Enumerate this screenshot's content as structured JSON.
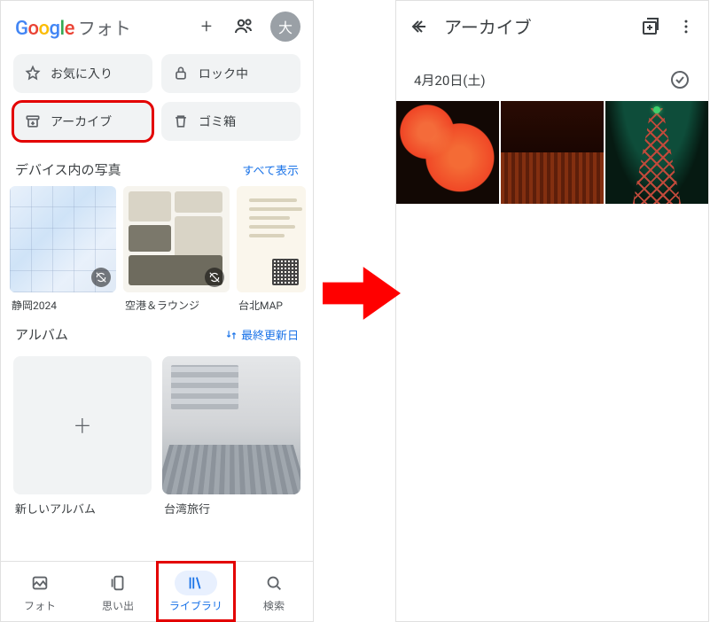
{
  "left": {
    "app_name_suffix": "フォト",
    "avatar_initial": "大",
    "chips": [
      {
        "label": "お気に入り"
      },
      {
        "label": "ロック中"
      },
      {
        "label": "アーカイブ"
      },
      {
        "label": "ゴミ箱"
      }
    ],
    "device_section": {
      "title": "デバイス内の写真",
      "action": "すべて表示",
      "items": [
        {
          "label": "静岡2024"
        },
        {
          "label": "空港＆ラウンジ"
        },
        {
          "label": "台北MAP"
        }
      ]
    },
    "album_section": {
      "title": "アルバム",
      "sort_label": "最終更新日",
      "items": [
        {
          "label": "新しいアルバム"
        },
        {
          "label": "台湾旅行"
        }
      ]
    },
    "nav": [
      {
        "label": "フォト"
      },
      {
        "label": "思い出"
      },
      {
        "label": "ライブラリ"
      },
      {
        "label": "検索"
      }
    ]
  },
  "right": {
    "title": "アーカイブ",
    "date_label": "4月20日(土)"
  }
}
